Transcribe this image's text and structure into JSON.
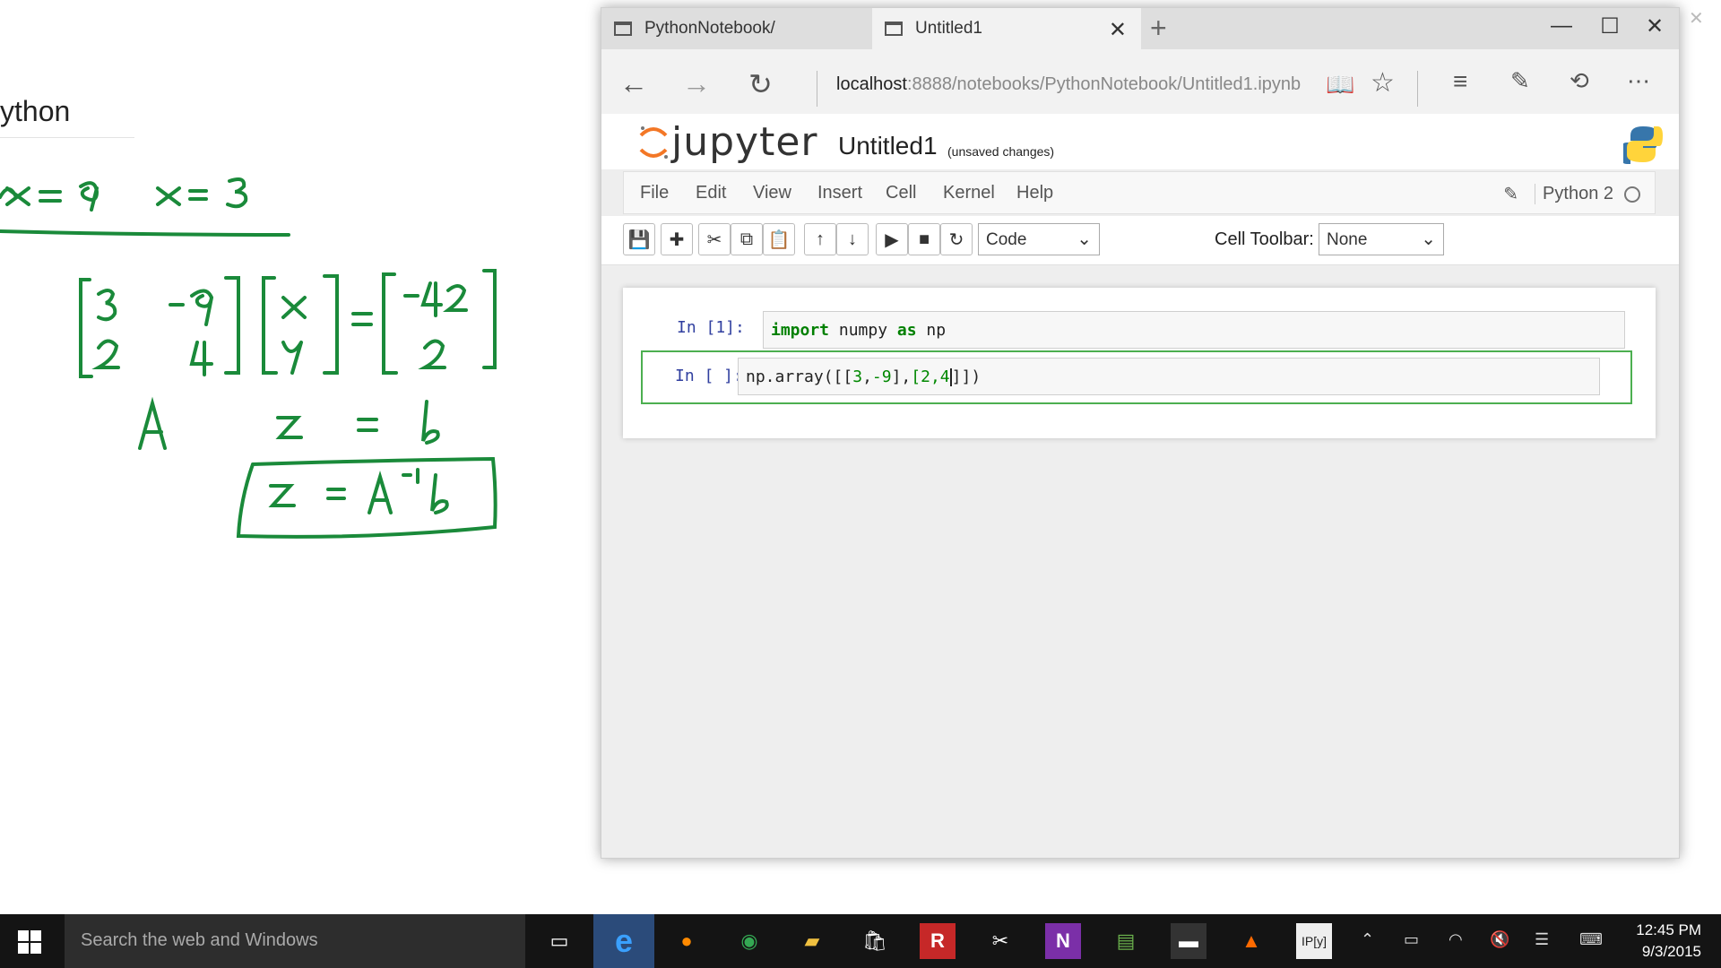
{
  "whiteboard": {
    "title": "ython",
    "handwriting": [
      "9x = 9",
      "x = 3",
      "A",
      "z",
      "=",
      "b",
      "z = A⁻¹b"
    ],
    "matrix_A": [
      [
        "3",
        "-9"
      ],
      [
        "2",
        "4"
      ]
    ],
    "vector_z": [
      "x",
      "y"
    ],
    "vector_b": [
      "-42",
      "2"
    ],
    "ink_color": "#1a8a3a"
  },
  "browser": {
    "tabs": [
      {
        "label": "PythonNotebook/"
      },
      {
        "label": "Untitled1"
      }
    ],
    "url_host": "localhost",
    "url_rest": ":8888/notebooks/PythonNotebook/Untitled1.ipynb",
    "icons": [
      "back-icon",
      "forward-icon",
      "refresh-icon",
      "reading-view-icon",
      "favorite-star-icon",
      "hub-icon",
      "web-note-icon",
      "share-icon",
      "more-icon"
    ]
  },
  "jupyter": {
    "logo_text": "jupyter",
    "notebook_name": "Untitled1",
    "save_status": "(unsaved changes)",
    "menus": [
      "File",
      "Edit",
      "View",
      "Insert",
      "Cell",
      "Kernel",
      "Help"
    ],
    "kernel": "Python 2",
    "cell_type": "Code",
    "cell_toolbar_label": "Cell Toolbar:",
    "cell_toolbar_value": "None",
    "cells": [
      {
        "prompt": "In [1]:",
        "code_kw1": "import",
        "code_mid": " numpy ",
        "code_kw2": "as",
        "code_end": " np"
      },
      {
        "prompt": "In [ ]:",
        "code_a": "np.array([[",
        "n1": "3",
        "c1": ",",
        "n2": "-9",
        "c2": "],",
        "n3": "[2,",
        "n4": "4",
        "c3": "]])"
      }
    ]
  },
  "taskbar": {
    "search_placeholder": "Search the web and Windows",
    "time": "12:45 PM",
    "date": "9/3/2015"
  }
}
